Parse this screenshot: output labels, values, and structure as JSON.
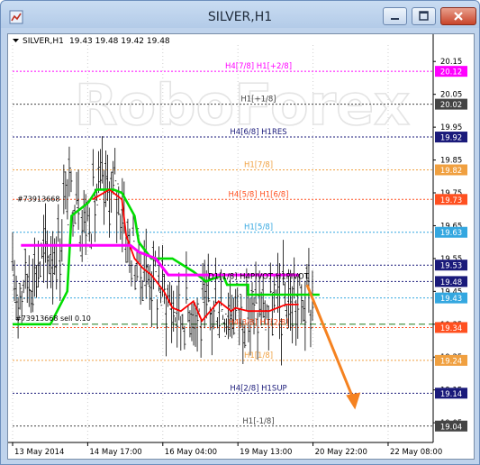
{
  "window": {
    "title": "SILVER,H1"
  },
  "header": {
    "symbol": "SILVER,H1",
    "values": "19.43 19.48 19.42 19.48"
  },
  "watermark": "RoboForex",
  "colors": {
    "magenta": "#ff00ff",
    "green": "#00dd00",
    "red": "#ff0000",
    "navy": "#1a1a7a",
    "orange": "#ff7a1a",
    "skyblue": "#34a7e0",
    "darkgray": "#444444",
    "forecast_arrow": "#f58220"
  },
  "chart_data": {
    "type": "candlestick",
    "symbol": "SILVER",
    "timeframe": "H1",
    "ohlc_last": {
      "open": 19.43,
      "high": 19.48,
      "low": 19.42,
      "close": 19.48
    },
    "y_ticks": [
      20.15,
      20.05,
      19.95,
      19.85,
      19.75,
      19.65,
      19.55,
      19.45,
      19.35,
      19.25,
      19.15,
      19.05
    ],
    "x_ticks": [
      "13 May 2014",
      "14 May 17:00",
      "16 May 04:00",
      "19 May 13:00",
      "20 May 22:00",
      "22 May 08:00"
    ],
    "price_range": [
      18.99,
      20.2
    ],
    "levels": [
      {
        "label": "H4[7/8] H1[+2/8]",
        "price": 20.12,
        "tag": "20.12",
        "color": "#ff00ff",
        "line_color": "#ff00ff",
        "tag_text_color": "#ffffff"
      },
      {
        "label": "H1[+1/8]",
        "price": 20.02,
        "tag": "20.02",
        "color": "#444444",
        "line_color": "#444444",
        "tag_text_color": "#ffffff"
      },
      {
        "label": "H4[6/8] H1RES",
        "price": 19.92,
        "tag": "19.92",
        "color": "#1a1a7a",
        "line_color": "#1a1a7a",
        "tag_text_color": "#ffffff"
      },
      {
        "label": "H1[7/8]",
        "price": 19.82,
        "tag": "19.82",
        "color": "#f0a040",
        "line_color": "#f0a040",
        "tag_text_color": "#ffffff"
      },
      {
        "label": "H4[5/8] H1[6/8]",
        "price": 19.73,
        "tag": "19.73",
        "color": "#ff5020",
        "line_color": "#ff5020",
        "tag_text_color": "#ffffff"
      },
      {
        "label": "H1[5/8]",
        "price": 19.63,
        "tag": "19.63",
        "color": "#34a7e0",
        "line_color": "#34a7e0",
        "tag_text_color": "#ffffff"
      },
      {
        "label": "",
        "price": 19.53,
        "tag": "19.53",
        "color": "#1a1a7a",
        "line_color": "#1a1a7a",
        "tag_text_color": "#ffffff"
      },
      {
        "label": "D1[1/8] H4PIVOT H1PIVOT",
        "price": 19.48,
        "tag": "19.48",
        "color": "#000000",
        "line_color": "#1a1a7a",
        "tag_text_color": "#ffffff"
      },
      {
        "label": "",
        "price": 19.43,
        "tag": "19.43",
        "color": "#34a7e0",
        "line_color": "#34a7e0",
        "tag_text_color": "#ffffff"
      },
      {
        "label": "H4[3/8] H1[2/8]",
        "price": 19.34,
        "tag": "19.34",
        "color": "#ff5020",
        "line_color": "#ff5020",
        "tag_text_color": "#ffffff"
      },
      {
        "label": "H1[1/8]",
        "price": 19.24,
        "tag": "19.24",
        "color": "#f0a040",
        "line_color": "#f0a040",
        "tag_text_color": "#ffffff"
      },
      {
        "label": "H4[2/8] H1SUP",
        "price": 19.14,
        "tag": "19.14",
        "color": "#1a1a7a",
        "line_color": "#1a1a7a",
        "tag_text_color": "#ffffff"
      },
      {
        "label": "H1[-1/8]",
        "price": 19.04,
        "tag": "19.04",
        "color": "#444444",
        "line_color": "#444444",
        "tag_text_color": "#ffffff"
      }
    ],
    "pending_order": {
      "label": "#73913668 sell 0.10",
      "price": 19.35,
      "tag": "19.34"
    },
    "order_marker": {
      "label": "#73913668",
      "price": 19.73
    },
    "series": [
      {
        "name": "",
        "color": "#00dd00",
        "points": [
          [
            0,
            19.35
          ],
          [
            0.09,
            19.35
          ],
          [
            0.13,
            19.45
          ],
          [
            0.14,
            19.68
          ],
          [
            0.18,
            19.72
          ],
          [
            0.2,
            19.76
          ],
          [
            0.24,
            19.76
          ],
          [
            0.26,
            19.75
          ],
          [
            0.29,
            19.68
          ],
          [
            0.3,
            19.6
          ],
          [
            0.33,
            19.55
          ],
          [
            0.38,
            19.55
          ],
          [
            0.43,
            19.51
          ],
          [
            0.46,
            19.48
          ],
          [
            0.5,
            19.5
          ],
          [
            0.51,
            19.47
          ],
          [
            0.54,
            19.47
          ],
          [
            0.56,
            19.47
          ],
          [
            0.56,
            19.44
          ],
          [
            0.6,
            19.44
          ],
          [
            0.64,
            19.44
          ],
          [
            0.73,
            19.44
          ]
        ]
      },
      {
        "name": "",
        "color": "#ff0000",
        "points": [
          [
            0.19,
            19.73
          ],
          [
            0.23,
            19.76
          ],
          [
            0.26,
            19.73
          ],
          [
            0.27,
            19.62
          ],
          [
            0.29,
            19.55
          ],
          [
            0.31,
            19.52
          ],
          [
            0.33,
            19.5
          ],
          [
            0.36,
            19.45
          ],
          [
            0.38,
            19.4
          ],
          [
            0.4,
            19.39
          ],
          [
            0.43,
            19.42
          ],
          [
            0.45,
            19.36
          ],
          [
            0.47,
            19.39
          ],
          [
            0.49,
            19.42
          ],
          [
            0.52,
            19.39
          ],
          [
            0.53,
            19.4
          ],
          [
            0.56,
            19.39
          ],
          [
            0.61,
            19.39
          ],
          [
            0.65,
            19.41
          ],
          [
            0.68,
            19.41
          ]
        ]
      },
      {
        "name": "",
        "color": "#ff00ff",
        "points": [
          [
            0.02,
            19.59
          ],
          [
            0.28,
            19.59
          ],
          [
            0.3,
            19.57
          ],
          [
            0.34,
            19.55
          ],
          [
            0.37,
            19.5
          ],
          [
            0.68,
            19.5
          ]
        ]
      }
    ],
    "candles_seed": 17,
    "forecast_arrow": {
      "from": [
        0.7,
        19.47
      ],
      "to": [
        0.81,
        19.09
      ]
    }
  }
}
